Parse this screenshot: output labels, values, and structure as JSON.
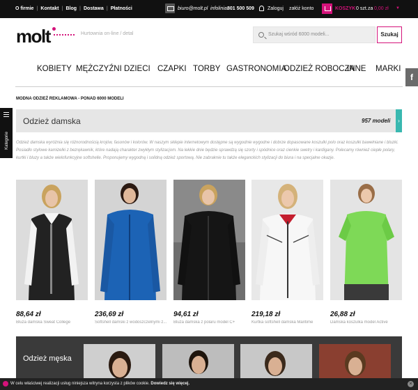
{
  "topbar": {
    "links": [
      "O firmie",
      "Kontakt",
      "Blog",
      "Dostawa",
      "Płatności"
    ],
    "email": "biuro@molt.pl",
    "phone_label": "infolinia:",
    "phone": "801 500 509",
    "login": "Zaloguj",
    "register": "załóż konto",
    "cart_label": "KOSZYK",
    "cart_qty": "0 szt.",
    "cart_za": "za",
    "cart_sum": "0,00 zł"
  },
  "header": {
    "logo": "molt",
    "tagline": "Hurtownia on-line / detal",
    "search_placeholder": "Szukaj wśród 6000 modeli...",
    "search_button": "Szukaj"
  },
  "nav": {
    "items": [
      "KOBIETY",
      "MĘŻCZYŹNI",
      "DZIECI",
      "CZAPKI",
      "TORBY",
      "GASTRONOMIA",
      "ODZIEŻ ROBOCZA",
      "INNE",
      "MARKI"
    ]
  },
  "sidebar": {
    "facebook": "f",
    "categories_label": "Kategorie"
  },
  "breadcrumb": "MODNA ODZIEŻ REKLAMOWA - PONAD 6000 MODELI",
  "category": {
    "title": "Odzież damska",
    "count": "957 modeli",
    "description": "Odzież damska wyróżnia się różnorodnością krojów, fasonów i kolorów. W naszym sklepie internetowym dostępne są wygodnie wygodne i dobrze dopasowane koszulki polo oraz koszulki bawełniane i bluzki. Posiadło stylowe kamizelki z bezrękawnik, które nadają charakter zwykłym stylizacjom. Na lekkie dnie będzie sprawdzą się szorty i spódnice oraz cienkie swetry i kardigany. Polecamy również ciepłe polary, kurtki i bluzy a także wielofunkcyjne softshelle. Proponujemy wygodną i solidną odzież sportową. Nie zabraknie tu także eleganckich stylizacji do biura i na specjalne okazje."
  },
  "products": [
    {
      "price": "88,64 zł",
      "name": "Bluza damska Sweat College"
    },
    {
      "price": "236,69 zł",
      "name": "Softshell damski z wodoszczelnymi z..."
    },
    {
      "price": "94,61 zł",
      "name": "Bluza damska z polaru model C+"
    },
    {
      "price": "219,18 zł",
      "name": "Kurtka softshell damska Maritime"
    },
    {
      "price": "26,88 zł",
      "name": "Damska koszulka model Active"
    }
  ],
  "men_section": {
    "title": "Odzież męska"
  },
  "cookie": {
    "text": "W celu właściwej realizacji usług niniejsza witryna korzysta z plików cookie.",
    "more": "Dowiedz się więcej.",
    "close": "×"
  }
}
